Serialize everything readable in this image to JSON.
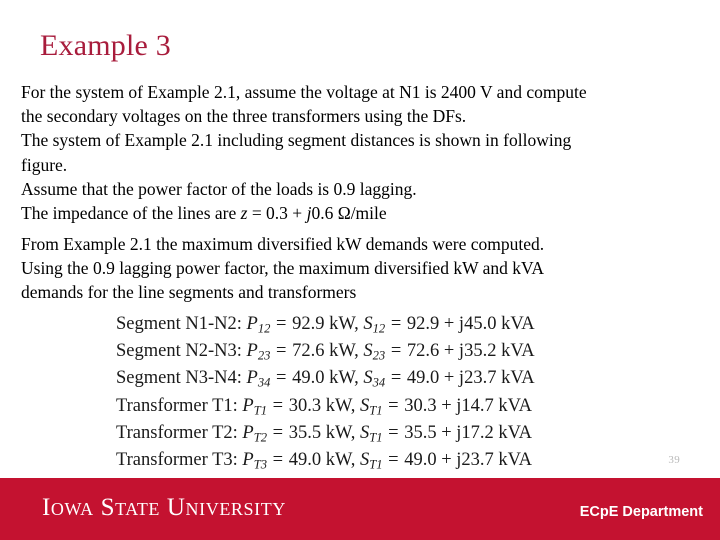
{
  "slide": {
    "title": "Example 3",
    "number": "39",
    "accent_color": "#c41230",
    "title_color": "#a81c3c"
  },
  "paragraph1": {
    "line1": "For the system of Example 2.1, assume the voltage at N1 is 2400 V and compute",
    "line2": "the secondary voltages on the three transformers using the DFs.",
    "line3": "The system of Example 2.1 including segment distances is shown in following",
    "line4": "figure.",
    "line5": "Assume that the power factor of the loads is 0.9 lagging.",
    "line6_prefix": "The impedance of the lines are ",
    "line6_z": "z",
    "line6_mid": " = 0.3 + ",
    "line6_j": "j",
    "line6_suffix": "0.6 Ω/mile"
  },
  "paragraph2": {
    "line1": "From Example 2.1 the maximum diversified kW demands were computed.",
    "line2": "Using the 0.9 lagging power factor, the maximum diversified kW and kVA",
    "line3": "demands for the line segments and transformers"
  },
  "equations": [
    {
      "label": "Segment N1-N2:",
      "p_symbol": "P",
      "p_sub": "12",
      "p_value": "92.9 kW",
      "s_symbol": "S",
      "s_sub": "12",
      "s_value": "92.9 + j45.0 kVA"
    },
    {
      "label": "Segment N2-N3:",
      "p_symbol": "P",
      "p_sub": "23",
      "p_value": "72.6 kW",
      "s_symbol": "S",
      "s_sub": "23",
      "s_value": "72.6 + j35.2 kVA"
    },
    {
      "label": "Segment N3-N4:",
      "p_symbol": "P",
      "p_sub": "34",
      "p_value": "49.0 kW",
      "s_symbol": "S",
      "s_sub": "34",
      "s_value": "49.0 + j23.7 kVA"
    },
    {
      "label": "Transformer T1:",
      "p_symbol": "P",
      "p_sub": "T1",
      "p_value": "30.3 kW",
      "s_symbol": "S",
      "s_sub": "T1",
      "s_value": "30.3 + j14.7 kVA"
    },
    {
      "label": "Transformer T2:",
      "p_symbol": "P",
      "p_sub": "T2",
      "p_value": "35.5 kW",
      "s_symbol": "S",
      "s_sub": "T1",
      "s_value": "35.5 + j17.2 kVA"
    },
    {
      "label": "Transformer T3:",
      "p_symbol": "P",
      "p_sub": "T3",
      "p_value": "49.0 kW",
      "s_symbol": "S",
      "s_sub": "T1",
      "s_value": "49.0 + j23.7 kVA"
    }
  ],
  "footer": {
    "logo_text": "Iowa State University",
    "department": "ECpE Department"
  }
}
